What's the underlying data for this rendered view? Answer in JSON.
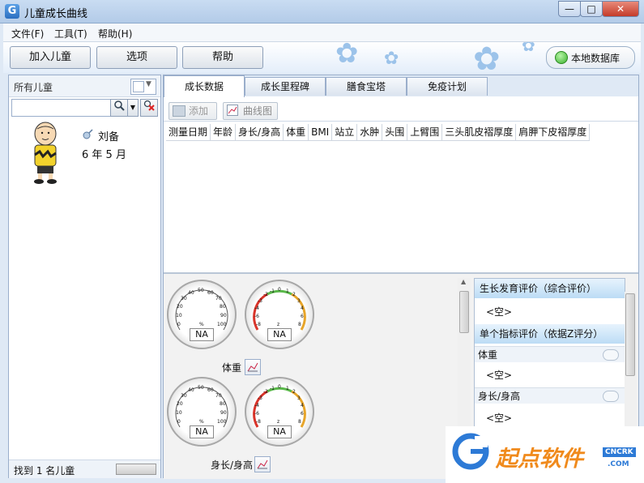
{
  "window": {
    "title": "儿童成长曲线",
    "app_icon_letter": "G",
    "min": "—",
    "max": "□",
    "close": "✕"
  },
  "menu": [
    "文件(F)",
    "工具(T)",
    "帮助(H)"
  ],
  "toolbar": {
    "add_child": "加入儿童",
    "options": "选项",
    "help": "帮助",
    "local_db": "本地数据库"
  },
  "left": {
    "filter_label": "所有儿童",
    "child": {
      "name": "刘备",
      "age": "6 年 5 月"
    },
    "footer": "找到 1 名儿童"
  },
  "tabs": [
    "成长数据",
    "成长里程碑",
    "膳食宝塔",
    "免疫计划"
  ],
  "subtoolbar": {
    "add": "添加",
    "curve": "曲线图"
  },
  "columns": [
    "测量日期",
    "年龄",
    "身长/身高",
    "体重",
    "BMI",
    "站立",
    "水肿",
    "头围",
    "上臂围",
    "三头肌皮褶厚度",
    "肩胛下皮褶厚度"
  ],
  "gauges": {
    "percentile_ticks": [
      "0",
      "10",
      "20",
      "30",
      "40",
      "50",
      "60",
      "70",
      "80",
      "90",
      "100"
    ],
    "z_ticks": [
      "-8",
      "-6",
      "-4",
      "-3",
      "-2",
      "-1",
      "0",
      "1",
      "2",
      "3",
      "4",
      "6",
      "8"
    ],
    "percentile_unit": "%",
    "z_unit": "z",
    "na": "NA",
    "weight_label": "体重",
    "height_label": "身长/身高"
  },
  "evaluation": {
    "overall_title": "生长发育评价（综合评价）",
    "overall_value": "<空>",
    "single_title": "单个指标评价（依据Z评分）",
    "items": [
      {
        "label": "体重",
        "value": "<空>"
      },
      {
        "label": "身长/身高",
        "value": "<空>"
      }
    ]
  },
  "watermark": {
    "text": "起点软件",
    "domain": "CNCRK",
    "dotcom": ".COM"
  },
  "colors": {
    "accent": "#3a7fd0",
    "watermark_orange": "#f08a1c",
    "watermark_blue": "#2d7ad6"
  }
}
